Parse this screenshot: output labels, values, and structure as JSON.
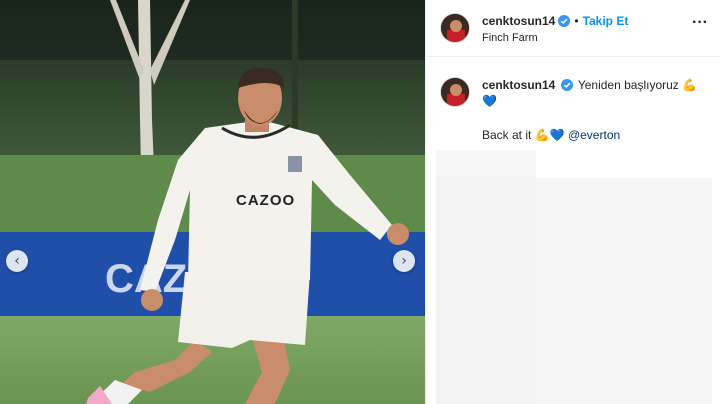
{
  "post": {
    "username": "cenktosun14",
    "follow_label": "Takip Et",
    "separator": "•",
    "location": "Finch Farm",
    "more_label": "···"
  },
  "photo": {
    "shirt_sponsor": "CAZOO",
    "banner_text": "CAZO"
  },
  "caption": {
    "username": "cenktosun14",
    "text": "Yeniden başlıyoruz",
    "emoji_1": "💪",
    "emoji_2": "💙",
    "line2_text": "Back at it",
    "line2_emoji_1": "💪",
    "line2_emoji_2": "💙",
    "mention": "@everton"
  },
  "nav": {
    "prev_glyph": "‹",
    "next_glyph": "›"
  },
  "colors": {
    "follow": "#0095f6",
    "verified": "#3897f0",
    "mention": "#00376b",
    "banner": "#1f4fa8"
  }
}
